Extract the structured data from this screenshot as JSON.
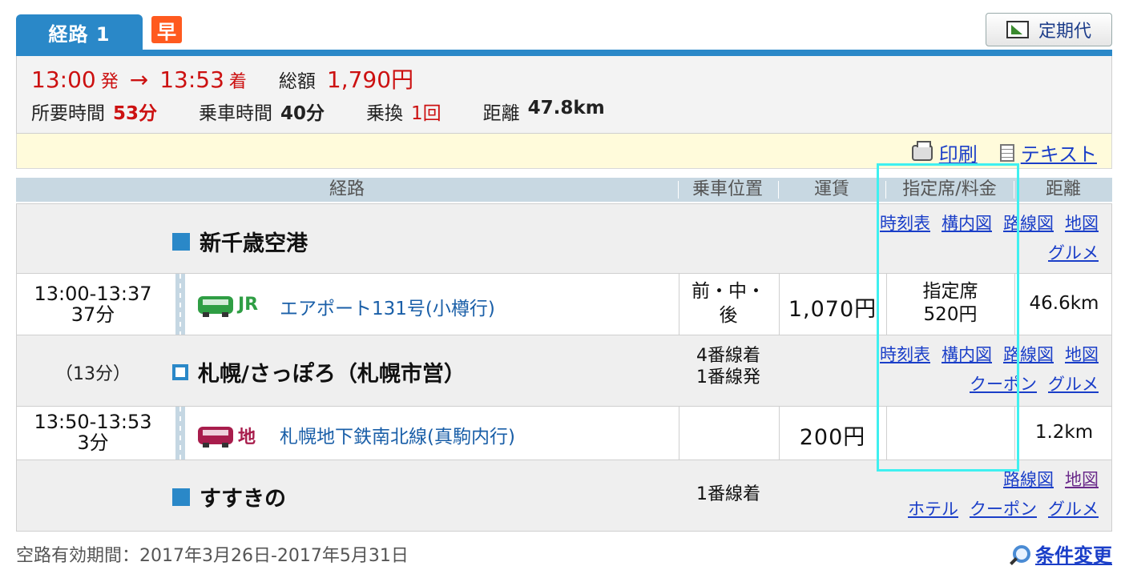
{
  "tab": {
    "route_label": "経路 1",
    "badge": "早"
  },
  "teiki_button": "定期代",
  "summary": {
    "depart_time": "13:00",
    "depart_suffix": "発",
    "arrow": "→",
    "arrive_time": "13:53",
    "arrive_suffix": "着",
    "total_label": "総額",
    "total_value": "1,790円",
    "duration_label": "所要時間",
    "duration_value": "53分",
    "ride_label": "乗車時間",
    "ride_value": "40分",
    "transfer_label": "乗換",
    "transfer_value": "1回",
    "distance_label": "距離",
    "distance_value": "47.8km"
  },
  "actions": {
    "print": "印刷",
    "text": "テキスト"
  },
  "headers": {
    "route": "経路",
    "position": "乗車位置",
    "fare": "運賃",
    "reserved": "指定席/料金",
    "distance": "距離"
  },
  "stations": [
    {
      "name": "新千歳空港",
      "wait": "",
      "platform": "",
      "links_line1": [
        "時刻表",
        "構内図",
        "路線図",
        "地図"
      ],
      "links_line2": [
        "グルメ"
      ]
    },
    {
      "name": "札幌/さっぽろ（札幌市営）",
      "wait": "（13分）",
      "platform_arrive": "4番線着",
      "platform_depart": "1番線発",
      "links_line1": [
        "時刻表",
        "構内図",
        "路線図",
        "地図"
      ],
      "links_line2": [
        "クーポン",
        "グルメ"
      ]
    },
    {
      "name": "すすきの",
      "wait": "",
      "platform": "1番線着",
      "links_line1": [
        "路線図",
        "地図"
      ],
      "links_line2": [
        "ホテル",
        "クーポン",
        "グルメ"
      ]
    }
  ],
  "segments": [
    {
      "time_range": "13:00-13:37",
      "duration": "37分",
      "operator": "JR",
      "operator_color": "#2f9e44",
      "line": "エアポート131号(小樽行)",
      "position_line1": "前・中・",
      "position_line2": "後",
      "fare": "1,070円",
      "reserved_line1": "指定席",
      "reserved_line2": "520円",
      "distance": "46.6km"
    },
    {
      "time_range": "13:50-13:53",
      "duration": "3分",
      "operator": "地",
      "operator_color": "#a81d4c",
      "line": "札幌地下鉄南北線(真駒内行)",
      "position_line1": "",
      "position_line2": "",
      "fare": "200円",
      "reserved_line1": "",
      "reserved_line2": "",
      "distance": "1.2km"
    }
  ],
  "footer": {
    "validity": "空路有効期間：2017年3月26日-2017年5月31日",
    "change_conditions": "条件変更"
  },
  "colors": {
    "accent": "#2a88c8",
    "price_red": "#cc1111",
    "link": "#1a3ec8",
    "highlight": "#3ff0f0"
  }
}
